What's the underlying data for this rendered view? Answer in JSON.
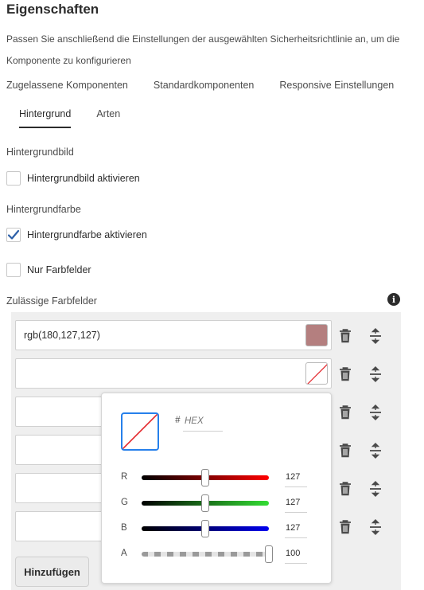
{
  "page": {
    "title": "Eigenschaften",
    "description": "Passen Sie anschließend die Einstellungen der ausgewählten Sicherheitsrichtlinie an, um die Komponente zu konfigurieren"
  },
  "tabs": [
    {
      "label": "Zugelassene Komponenten"
    },
    {
      "label": "Standardkomponenten"
    },
    {
      "label": "Responsive Einstellungen"
    }
  ],
  "subtabs": [
    {
      "label": "Hintergrund",
      "active": true
    },
    {
      "label": "Arten",
      "active": false
    }
  ],
  "background_image": {
    "section_label": "Hintergrundbild",
    "checkbox_label": "Hintergrundbild aktivieren",
    "checked": false
  },
  "background_color": {
    "section_label": "Hintergrundfarbe",
    "checkbox_label": "Hintergrundfarbe aktivieren",
    "checked": true,
    "only_swatches_label": "Nur Farbfelder",
    "only_swatches_checked": false
  },
  "swatches": {
    "label": "Zulässige Farbfelder",
    "info_icon": "info-icon",
    "rows": [
      {
        "value": "rgb(180,127,127)",
        "color": "#b47f7f"
      },
      {
        "value": "",
        "color": ""
      },
      {
        "value": "",
        "color": ""
      },
      {
        "value": "",
        "color": ""
      },
      {
        "value": "",
        "color": ""
      },
      {
        "value": "",
        "color": ""
      }
    ],
    "row_icons": [
      "trash-icon",
      "reorder-icon"
    ],
    "add_button_label": "Hinzufügen"
  },
  "color_picker": {
    "hex_prefix": "#",
    "hex_placeholder": "HEX",
    "channels": [
      {
        "label": "R",
        "value": "127",
        "fraction": 0.498
      },
      {
        "label": "G",
        "value": "127",
        "fraction": 0.498
      },
      {
        "label": "B",
        "value": "127",
        "fraction": 0.498
      },
      {
        "label": "A",
        "value": "100",
        "fraction": 1.0
      }
    ]
  },
  "colors": {
    "accent": "#2680eb",
    "checkmark": "#2c5fa8",
    "swatch": "#b47f7f",
    "empty_swatch_slash": "#e3262b"
  }
}
